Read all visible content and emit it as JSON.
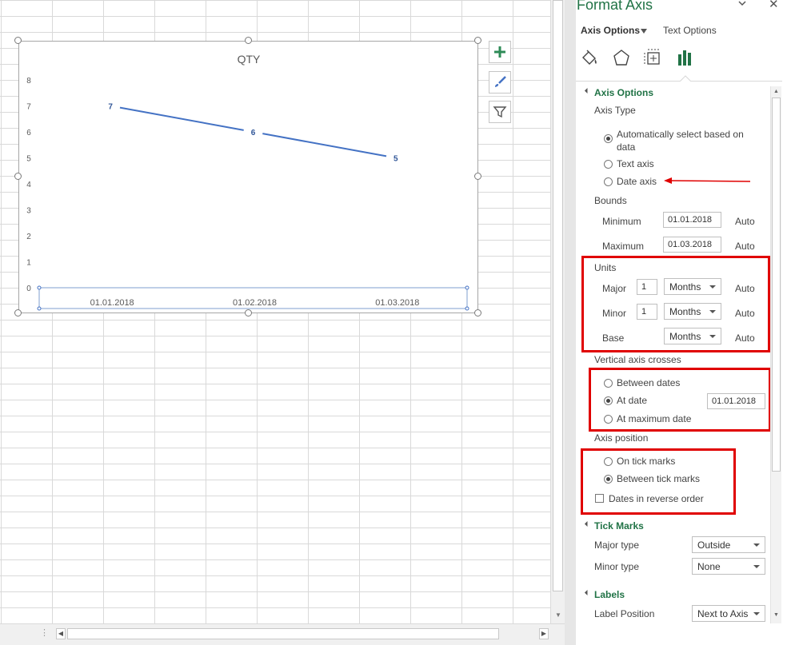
{
  "chart": {
    "title": "QTY",
    "y_ticks": [
      "0",
      "1",
      "2",
      "3",
      "4",
      "5",
      "6",
      "7",
      "8"
    ],
    "x_ticks": [
      "01.01.2018",
      "01.02.2018",
      "01.03.2018"
    ],
    "data_labels": [
      "7",
      "6",
      "5"
    ],
    "line_color": "#4472c4"
  },
  "chart_data": {
    "type": "line",
    "title": "QTY",
    "categories": [
      "01.01.2018",
      "01.02.2018",
      "01.03.2018"
    ],
    "series": [
      {
        "values": [
          7,
          6,
          5
        ]
      }
    ],
    "ylim": [
      0,
      8
    ],
    "y_ticks": [
      0,
      1,
      2,
      3,
      4,
      5,
      6,
      7,
      8
    ],
    "xlabel": "",
    "ylabel": "",
    "data_labels": true,
    "grid": false
  },
  "pane": {
    "title": "Format Axis",
    "tab_axis_options": "Axis Options",
    "tab_text_options": "Text Options",
    "icons": [
      "fill-line-icon",
      "effects-icon",
      "size-properties-icon",
      "axis-options-icon"
    ],
    "axis_options_header": "Axis Options",
    "axis_type_label": "Axis Type",
    "axis_type_auto_line1": "Automatically select based on",
    "axis_type_auto_line2": "data",
    "axis_type_text": "Text axis",
    "axis_type_date": "Date axis",
    "bounds_label": "Bounds",
    "min_label": "Minimum",
    "min_value": "01.01.2018",
    "min_auto": "Auto",
    "max_label": "Maximum",
    "max_value": "01.03.2018",
    "max_auto": "Auto",
    "units_label": "Units",
    "major_label": "Major",
    "major_value": "1",
    "major_unit": "Months",
    "major_auto": "Auto",
    "minor_label": "Minor",
    "minor_value": "1",
    "minor_unit": "Months",
    "minor_auto": "Auto",
    "base_label": "Base",
    "base_unit": "Months",
    "base_auto": "Auto",
    "crosses_label": "Vertical axis crosses",
    "cross_between": "Between dates",
    "cross_at_date": "At date",
    "cross_at_date_value": "01.01.2018",
    "cross_max": "At maximum date",
    "axis_position_label": "Axis position",
    "pos_on_tick": "On tick marks",
    "pos_between_tick": "Between tick marks",
    "reverse_order": "Dates in reverse order",
    "tick_marks_header": "Tick Marks",
    "major_type_label": "Major type",
    "major_type_value": "Outside",
    "minor_type_label": "Minor type",
    "minor_type_value": "None",
    "labels_header": "Labels",
    "label_position_label": "Label Position",
    "label_position_value": "Next to Axis"
  },
  "colors": {
    "accent_green": "#217346",
    "highlight_red": "#e00000",
    "series_blue": "#4472c4"
  }
}
